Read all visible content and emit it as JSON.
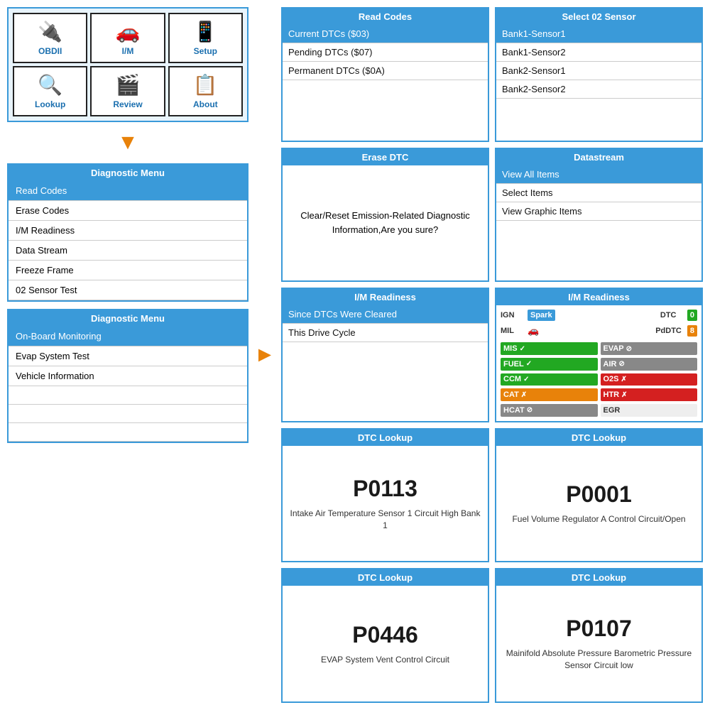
{
  "appGrid": {
    "cells": [
      {
        "id": "obdii",
        "icon": "🔌",
        "label": "OBDII",
        "highlighted": false
      },
      {
        "id": "im",
        "icon": "🚗",
        "label": "I/M",
        "highlighted": false
      },
      {
        "id": "setup",
        "icon": "📱",
        "label": "Setup",
        "highlighted": false
      },
      {
        "id": "lookup",
        "icon": "🔍",
        "label": "Lookup",
        "highlighted": false
      },
      {
        "id": "review",
        "icon": "🎬",
        "label": "Review",
        "highlighted": false
      },
      {
        "id": "about",
        "icon": "📋",
        "label": "About",
        "highlighted": false
      }
    ]
  },
  "diagMenu1": {
    "title": "Diagnostic Menu",
    "items": [
      {
        "label": "Read Codes",
        "selected": true
      },
      {
        "label": "Erase Codes",
        "selected": false
      },
      {
        "label": "I/M Readiness",
        "selected": false
      },
      {
        "label": "Data Stream",
        "selected": false
      },
      {
        "label": "Freeze Frame",
        "selected": false
      },
      {
        "label": "02 Sensor Test",
        "selected": false
      }
    ]
  },
  "diagMenu2": {
    "title": "Diagnostic Menu",
    "items": [
      {
        "label": "On-Board Monitoring",
        "selected": true
      },
      {
        "label": "Evap System Test",
        "selected": false
      },
      {
        "label": "Vehicle Information",
        "selected": false
      },
      {
        "label": "",
        "selected": false
      },
      {
        "label": "",
        "selected": false
      },
      {
        "label": "",
        "selected": false
      }
    ]
  },
  "readCodes": {
    "title": "Read Codes",
    "items": [
      {
        "label": "Current DTCs ($03)",
        "selected": true
      },
      {
        "label": "Pending DTCs ($07)",
        "selected": false
      },
      {
        "label": "Permanent DTCs ($0A)",
        "selected": false
      }
    ]
  },
  "selectSensor": {
    "title": "Select 02 Sensor",
    "items": [
      {
        "label": "Bank1-Sensor1",
        "selected": true
      },
      {
        "label": "Bank1-Sensor2",
        "selected": false
      },
      {
        "label": "Bank2-Sensor1",
        "selected": false
      },
      {
        "label": "Bank2-Sensor2",
        "selected": false
      }
    ]
  },
  "eraseDTC": {
    "title": "Erase DTC",
    "message": "Clear/Reset Emission-Related Diagnostic Information,Are you sure?"
  },
  "datastream": {
    "title": "Datastream",
    "items": [
      {
        "label": "View All Items",
        "selected": true
      },
      {
        "label": "Select Items",
        "selected": false
      },
      {
        "label": "View Graphic Items",
        "selected": false
      }
    ]
  },
  "imReadinessLeft": {
    "title": "I/M Readiness",
    "items": [
      {
        "label": "Since DTCs Were Cleared",
        "selected": true
      },
      {
        "label": "This Drive Cycle",
        "selected": false
      }
    ]
  },
  "imReadinessRight": {
    "title": "I/M Readiness",
    "ign_label": "IGN",
    "ign_value": "Spark",
    "dtc_label": "DTC",
    "dtc_value": "0",
    "mil_label": "MIL",
    "mil_icon": "🚗",
    "pddtc_label": "PdDTC",
    "pddtc_value": "8",
    "statuses": [
      {
        "label": "MIS",
        "color": "green",
        "status": "check",
        "col": 1
      },
      {
        "label": "EVAP",
        "color": "gray",
        "status": "circle",
        "col": 2
      },
      {
        "label": "FUEL",
        "color": "green",
        "status": "check",
        "col": 1
      },
      {
        "label": "AIR",
        "color": "gray",
        "status": "circle",
        "col": 2
      },
      {
        "label": "CCM",
        "color": "green",
        "status": "check",
        "col": 1
      },
      {
        "label": "O2S",
        "color": "red",
        "status": "x",
        "col": 2
      },
      {
        "label": "CAT",
        "color": "orange",
        "status": "x",
        "col": 1
      },
      {
        "label": "HTR",
        "color": "red",
        "status": "x",
        "col": 2
      },
      {
        "label": "HCAT",
        "color": "gray",
        "status": "circle",
        "col": 1
      },
      {
        "label": "EGR",
        "color": "gray",
        "status": "",
        "col": 2
      }
    ]
  },
  "dtc1": {
    "title": "DTC Lookup",
    "code": "P0113",
    "desc": "Intake Air Temperature Sensor 1 Circuit High Bank 1"
  },
  "dtc2": {
    "title": "DTC Lookup",
    "code": "P0001",
    "desc": "Fuel Volume Regulator A Control Circuit/Open"
  },
  "dtc3": {
    "title": "DTC Lookup",
    "code": "P0446",
    "desc": "EVAP System Vent Control Circuit"
  },
  "dtc4": {
    "title": "DTC Lookup",
    "code": "P0107",
    "desc": "Mainifold Absolute Pressure Barometric Pressure Sensor Circuit low"
  }
}
